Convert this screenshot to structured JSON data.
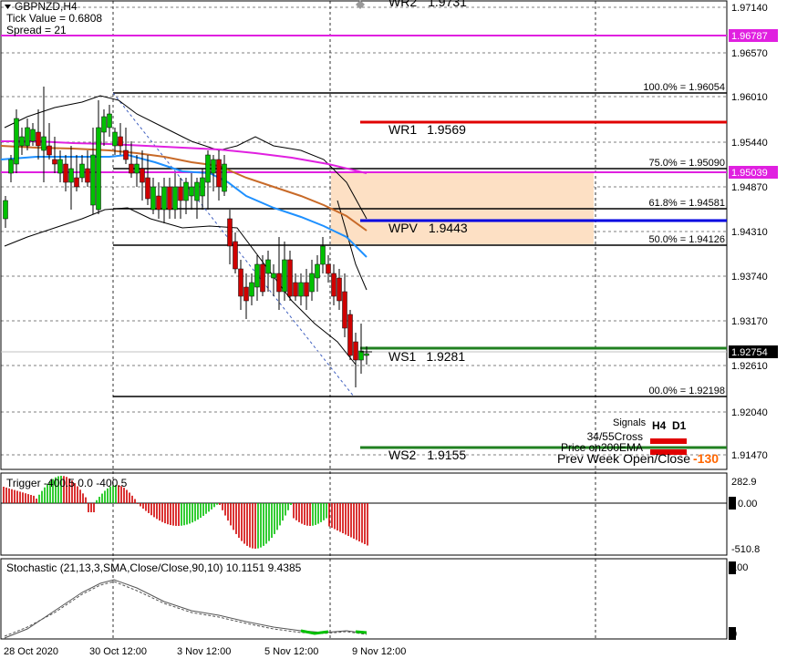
{
  "header": {
    "symbol": "GBPNZD,H4",
    "tick_value": "Tick Value = 0.6808",
    "spread": "Spread = 21"
  },
  "price_axis": {
    "ticks": [
      "1.97140",
      "1.96570",
      "1.96010",
      "1.95440",
      "1.94870",
      "1.94310",
      "1.93740",
      "1.93170",
      "1.92610",
      "1.92040",
      "1.91470"
    ],
    "current_price": "1.92754",
    "marker_high": "1.96787",
    "marker_mid": "1.95039"
  },
  "pivots": [
    {
      "label": "WR2",
      "value": "1.9731"
    },
    {
      "label": "WR1",
      "value": "1.9569"
    },
    {
      "label": "WPV",
      "value": "1.9443"
    },
    {
      "label": "WS1",
      "value": "1.9281"
    },
    {
      "label": "WS2",
      "value": "1.9155"
    }
  ],
  "fibonacci": [
    {
      "label": "100.0% = 1.96054"
    },
    {
      "label": "75.0% = 1.95090"
    },
    {
      "label": "61.8% = 1.94581"
    },
    {
      "label": "50.0% = 1.94126"
    },
    {
      "label": "00.0% = 1.92198"
    }
  ],
  "signals": {
    "title": "Signals",
    "col_h4": "H4",
    "col_d1": "D1",
    "row1": "34/55Cross",
    "row2": "Price on200EMA",
    "prev_week_label": "Prev Week Open/Close",
    "prev_week_value": "-130",
    "colors": {
      "signal": "#e00000",
      "value": "#ff6600"
    }
  },
  "trigger": {
    "title": "Trigger -400.5 0.0 -400.5",
    "ticks": [
      "282.9",
      "0.00",
      "-510.8"
    ]
  },
  "stochastic": {
    "title": "Stochastic (21,13,3,SMA,Close/Close,90,10) 10.1151 9.4385",
    "ticks": [
      "100",
      "0"
    ]
  },
  "time_axis": [
    "28 Oct 2020",
    "30 Oct 12:00",
    "3 Nov 12:00",
    "5 Nov 12:00",
    "9 Nov 12:00"
  ],
  "colors": {
    "bull": "#00c000",
    "bear": "#d00000",
    "magenta": "#e020e0",
    "blue_ma": "#1e90ff",
    "orange_ma": "#c86a28",
    "wr1": "#e00000",
    "wpv": "#0000e0",
    "support": "#208020",
    "zone": "#fde0c4"
  }
}
